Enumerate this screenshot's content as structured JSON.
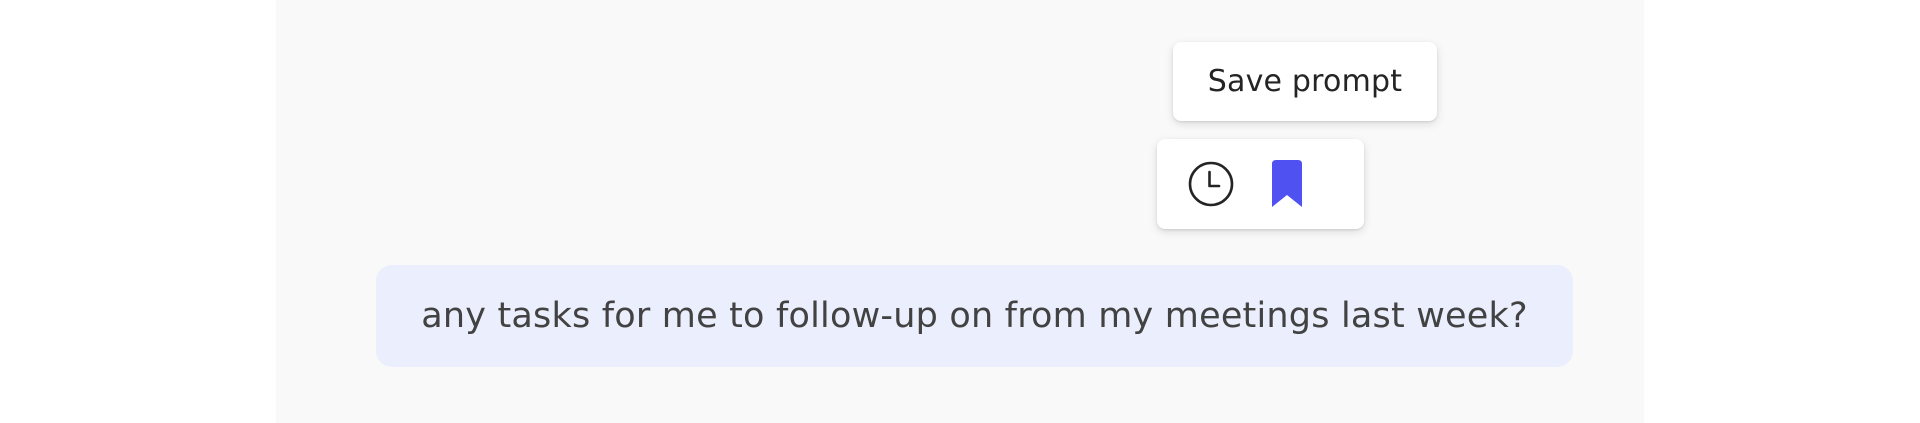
{
  "tooltip": {
    "text": "Save prompt"
  },
  "toolbar": {
    "buttons": [
      {
        "icon": "clock-icon",
        "name": "history"
      },
      {
        "icon": "bookmark-icon",
        "name": "save-prompt",
        "active": true
      }
    ]
  },
  "message": {
    "text": "any tasks for me to follow-up on from my meetings last week?"
  },
  "colors": {
    "accent": "#4f52f0",
    "bubble": "#ebeefc",
    "panel": "#f9f9f9"
  }
}
